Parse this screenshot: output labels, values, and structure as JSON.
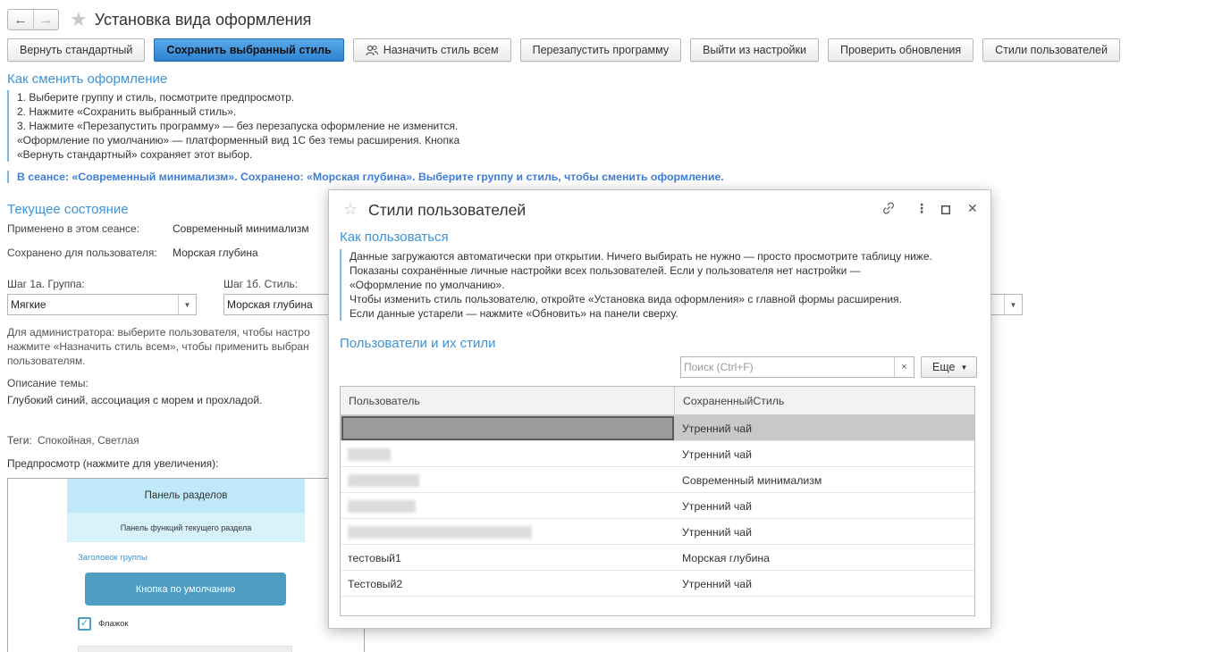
{
  "window": {
    "title": "Установка вида оформления",
    "back_icon": "←",
    "forward_icon": "→",
    "favorite_icon": "★"
  },
  "toolbar": {
    "reset_label": "Вернуть стандартный",
    "save_label": "Сохранить выбранный стиль",
    "assign_all_label": "Назначить стиль всем",
    "restart_label": "Перезапустить программу",
    "exit_label": "Выйти из настройки",
    "check_updates_label": "Проверить обновления",
    "user_styles_label": "Стили пользователей"
  },
  "howto": {
    "title": "Как сменить оформление",
    "lines": [
      "1. Выберите группу и стиль, посмотрите предпросмотр.",
      "2. Нажмите «Сохранить выбранный стиль».",
      "3. Нажмите «Перезапустить программу» — без перезапуска оформление не изменится.",
      "«Оформление по умолчанию» — платформенный вид 1С без темы расширения. Кнопка",
      "«Вернуть стандартный» сохраняет этот выбор."
    ],
    "session_note": "В сеансе: «Современный минимализм». Сохранено: «Морская глубина». Выберите группу и стиль, чтобы сменить оформление."
  },
  "state": {
    "title": "Текущее состояние",
    "session_label": "Применено в этом сеансе:",
    "session_value": "Современный минимализм",
    "saved_label": "Сохранено для пользователя:",
    "saved_value": "Морская глубина",
    "group_label": "Шаг 1а. Группа:",
    "group_value": "Мягкие",
    "style_label": "Шаг 1б. Стиль:",
    "style_value": "Морская глубина",
    "admin_note_1": "Для администратора: выберите пользователя, чтобы настро",
    "admin_note_2": "нажмите «Назначить стиль всем», чтобы применить выбран",
    "admin_note_3": "пользователям.",
    "desc_label": "Описание темы:",
    "desc_value": "Глубокий синий, ассоциация с морем и прохладой.",
    "tags_label": "Теги:",
    "tags_value": "Спокойная, Светлая",
    "preview_label": "Предпросмотр (нажмите для увеличения):"
  },
  "preview": {
    "sections_panel": "Панель разделов",
    "functions_panel": "Панель функций текущего раздела",
    "group_header": "Заголовок группы",
    "default_button": "Кнопка по умолчанию",
    "checkbox": "Флажок",
    "checkbox_mark": "✓"
  },
  "dialog": {
    "title": "Стили пользователей",
    "link_icon": "🔗",
    "menu_icon": "⋮",
    "maximize_icon": "☐",
    "close_icon": "✕",
    "howto_title": "Как пользоваться",
    "howto_lines": [
      "Данные загружаются автоматически при открытии. Ничего выбирать не нужно — просто просмотрите таблицу ниже.",
      "Показаны сохранённые личные настройки всех пользователей. Если у пользователя нет настройки —",
      "«Оформление по умолчанию».",
      "Чтобы изменить стиль пользователю, откройте «Установка вида оформления» с главной формы расширения.",
      "Если данные устарели — нажмите «Обновить» на панели сверху."
    ],
    "users_title": "Пользователи и их стили",
    "search_placeholder": "Поиск (Ctrl+F)",
    "clear_icon": "×",
    "more_label": "Еще",
    "columns": [
      "Пользователь",
      "СохраненныйСтиль"
    ],
    "rows": [
      {
        "user": "",
        "style": "Утренний чай"
      },
      {
        "user": "",
        "style": "Утренний чай"
      },
      {
        "user": "",
        "style": "Современный минимализм"
      },
      {
        "user": "",
        "style": "Утренний чай"
      },
      {
        "user": "",
        "style": "Утренний чай"
      },
      {
        "user": "тестовый1",
        "style": "Морская глубина"
      },
      {
        "user": "Тестовый2",
        "style": "Утренний чай"
      }
    ]
  }
}
